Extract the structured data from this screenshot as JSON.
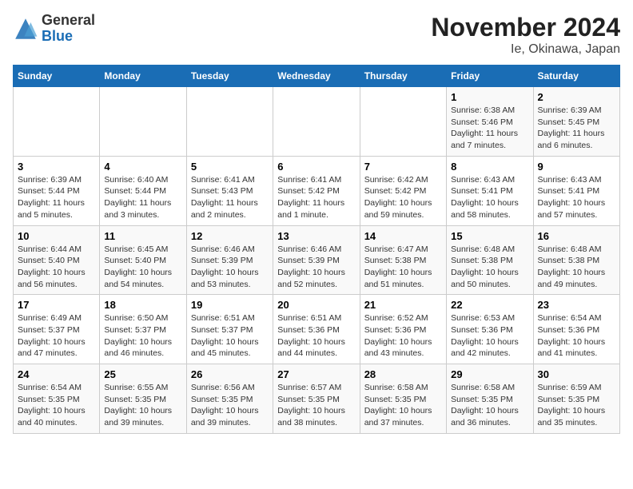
{
  "logo": {
    "general": "General",
    "blue": "Blue"
  },
  "title": "November 2024",
  "subtitle": "Ie, Okinawa, Japan",
  "days_of_week": [
    "Sunday",
    "Monday",
    "Tuesday",
    "Wednesday",
    "Thursday",
    "Friday",
    "Saturday"
  ],
  "weeks": [
    [
      {
        "day": "",
        "info": ""
      },
      {
        "day": "",
        "info": ""
      },
      {
        "day": "",
        "info": ""
      },
      {
        "day": "",
        "info": ""
      },
      {
        "day": "",
        "info": ""
      },
      {
        "day": "1",
        "info": "Sunrise: 6:38 AM\nSunset: 5:46 PM\nDaylight: 11 hours and 7 minutes."
      },
      {
        "day": "2",
        "info": "Sunrise: 6:39 AM\nSunset: 5:45 PM\nDaylight: 11 hours and 6 minutes."
      }
    ],
    [
      {
        "day": "3",
        "info": "Sunrise: 6:39 AM\nSunset: 5:44 PM\nDaylight: 11 hours and 5 minutes."
      },
      {
        "day": "4",
        "info": "Sunrise: 6:40 AM\nSunset: 5:44 PM\nDaylight: 11 hours and 3 minutes."
      },
      {
        "day": "5",
        "info": "Sunrise: 6:41 AM\nSunset: 5:43 PM\nDaylight: 11 hours and 2 minutes."
      },
      {
        "day": "6",
        "info": "Sunrise: 6:41 AM\nSunset: 5:42 PM\nDaylight: 11 hours and 1 minute."
      },
      {
        "day": "7",
        "info": "Sunrise: 6:42 AM\nSunset: 5:42 PM\nDaylight: 10 hours and 59 minutes."
      },
      {
        "day": "8",
        "info": "Sunrise: 6:43 AM\nSunset: 5:41 PM\nDaylight: 10 hours and 58 minutes."
      },
      {
        "day": "9",
        "info": "Sunrise: 6:43 AM\nSunset: 5:41 PM\nDaylight: 10 hours and 57 minutes."
      }
    ],
    [
      {
        "day": "10",
        "info": "Sunrise: 6:44 AM\nSunset: 5:40 PM\nDaylight: 10 hours and 56 minutes."
      },
      {
        "day": "11",
        "info": "Sunrise: 6:45 AM\nSunset: 5:40 PM\nDaylight: 10 hours and 54 minutes."
      },
      {
        "day": "12",
        "info": "Sunrise: 6:46 AM\nSunset: 5:39 PM\nDaylight: 10 hours and 53 minutes."
      },
      {
        "day": "13",
        "info": "Sunrise: 6:46 AM\nSunset: 5:39 PM\nDaylight: 10 hours and 52 minutes."
      },
      {
        "day": "14",
        "info": "Sunrise: 6:47 AM\nSunset: 5:38 PM\nDaylight: 10 hours and 51 minutes."
      },
      {
        "day": "15",
        "info": "Sunrise: 6:48 AM\nSunset: 5:38 PM\nDaylight: 10 hours and 50 minutes."
      },
      {
        "day": "16",
        "info": "Sunrise: 6:48 AM\nSunset: 5:38 PM\nDaylight: 10 hours and 49 minutes."
      }
    ],
    [
      {
        "day": "17",
        "info": "Sunrise: 6:49 AM\nSunset: 5:37 PM\nDaylight: 10 hours and 47 minutes."
      },
      {
        "day": "18",
        "info": "Sunrise: 6:50 AM\nSunset: 5:37 PM\nDaylight: 10 hours and 46 minutes."
      },
      {
        "day": "19",
        "info": "Sunrise: 6:51 AM\nSunset: 5:37 PM\nDaylight: 10 hours and 45 minutes."
      },
      {
        "day": "20",
        "info": "Sunrise: 6:51 AM\nSunset: 5:36 PM\nDaylight: 10 hours and 44 minutes."
      },
      {
        "day": "21",
        "info": "Sunrise: 6:52 AM\nSunset: 5:36 PM\nDaylight: 10 hours and 43 minutes."
      },
      {
        "day": "22",
        "info": "Sunrise: 6:53 AM\nSunset: 5:36 PM\nDaylight: 10 hours and 42 minutes."
      },
      {
        "day": "23",
        "info": "Sunrise: 6:54 AM\nSunset: 5:36 PM\nDaylight: 10 hours and 41 minutes."
      }
    ],
    [
      {
        "day": "24",
        "info": "Sunrise: 6:54 AM\nSunset: 5:35 PM\nDaylight: 10 hours and 40 minutes."
      },
      {
        "day": "25",
        "info": "Sunrise: 6:55 AM\nSunset: 5:35 PM\nDaylight: 10 hours and 39 minutes."
      },
      {
        "day": "26",
        "info": "Sunrise: 6:56 AM\nSunset: 5:35 PM\nDaylight: 10 hours and 39 minutes."
      },
      {
        "day": "27",
        "info": "Sunrise: 6:57 AM\nSunset: 5:35 PM\nDaylight: 10 hours and 38 minutes."
      },
      {
        "day": "28",
        "info": "Sunrise: 6:58 AM\nSunset: 5:35 PM\nDaylight: 10 hours and 37 minutes."
      },
      {
        "day": "29",
        "info": "Sunrise: 6:58 AM\nSunset: 5:35 PM\nDaylight: 10 hours and 36 minutes."
      },
      {
        "day": "30",
        "info": "Sunrise: 6:59 AM\nSunset: 5:35 PM\nDaylight: 10 hours and 35 minutes."
      }
    ]
  ]
}
